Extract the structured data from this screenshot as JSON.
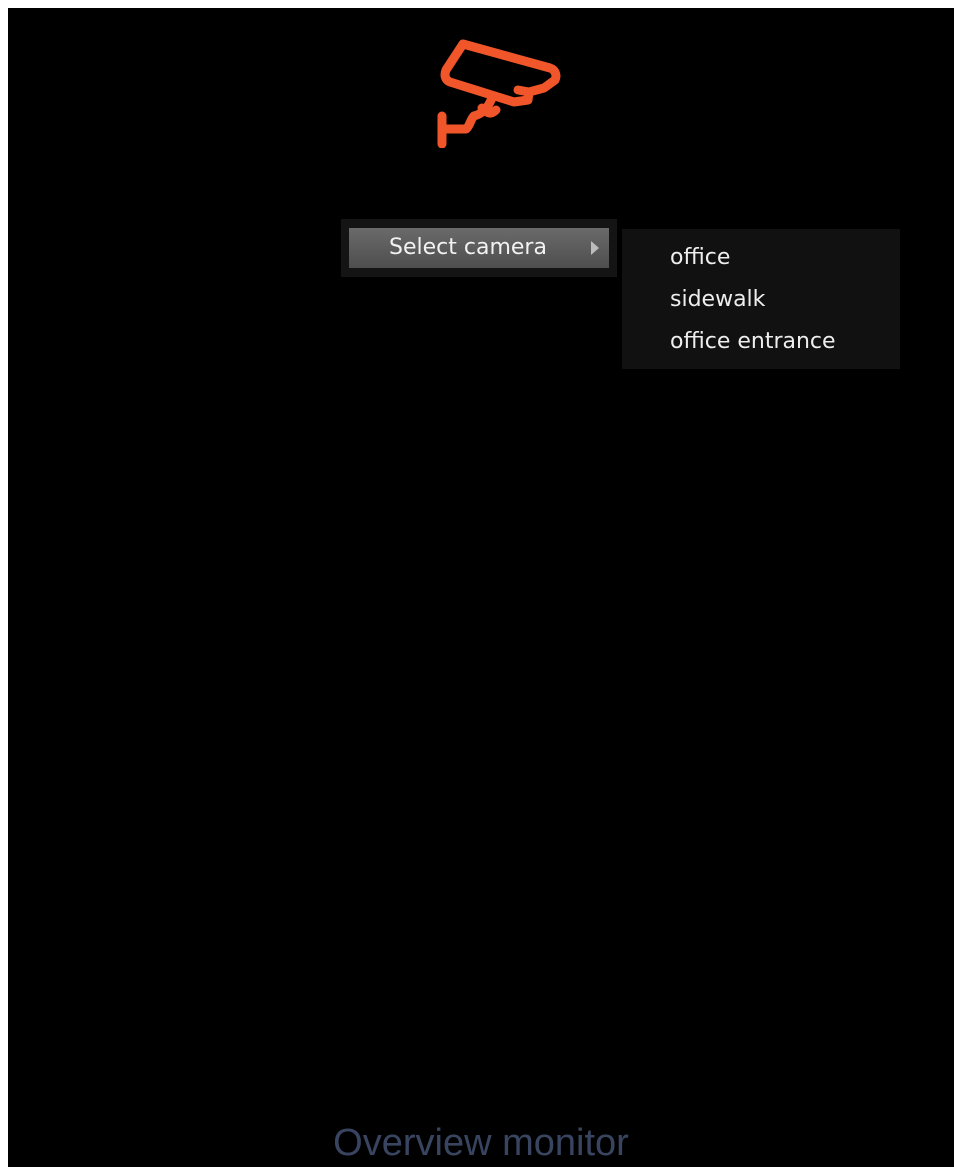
{
  "logo": {
    "icon": "security-camera-icon",
    "color": "#f0562a"
  },
  "context_menu": {
    "item_label": "Select camera",
    "submenu_arrow_icon": "chevron-right-icon"
  },
  "submenu": {
    "items": [
      {
        "label": "office"
      },
      {
        "label": "sidewalk"
      },
      {
        "label": "office entrance"
      }
    ]
  },
  "footer": {
    "title": "Overview monitor"
  }
}
